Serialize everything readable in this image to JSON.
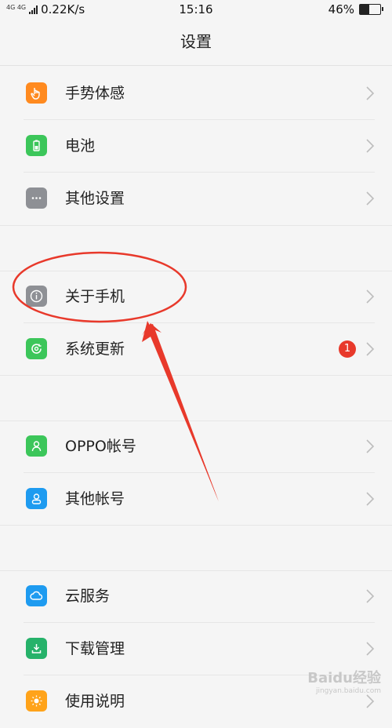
{
  "status_bar": {
    "network": "4G 4G",
    "speed": "0.22K/s",
    "time": "15:16",
    "battery": "46%",
    "battery_level": 0.46
  },
  "header": {
    "title": "设置"
  },
  "items": [
    {
      "label": "手势体感",
      "icon": "hand-gesture-icon",
      "color": "#ff8a1f"
    },
    {
      "label": "电池",
      "icon": "battery-icon",
      "color": "#3cc65a"
    },
    {
      "label": "其他设置",
      "icon": "more-dots-icon",
      "color": "#8e9095"
    },
    {
      "label": "关于手机",
      "icon": "info-icon",
      "color": "#8e9095"
    },
    {
      "label": "系统更新",
      "icon": "system-update-icon",
      "color": "#3cc65a",
      "badge": "1"
    },
    {
      "label": "OPPO帐号",
      "icon": "oppo-account-icon",
      "color": "#3cc65a"
    },
    {
      "label": "其他帐号",
      "icon": "other-account-icon",
      "color": "#1e9bf0"
    },
    {
      "label": "云服务",
      "icon": "cloud-icon",
      "color": "#1e9bf0"
    },
    {
      "label": "下载管理",
      "icon": "download-icon",
      "color": "#26b26a"
    },
    {
      "label": "使用说明",
      "icon": "help-icon",
      "color": "#ffa31a"
    }
  ],
  "colors": {
    "annotation": "#e8392b"
  },
  "watermark": {
    "text": "Baidu经验",
    "subtext": "jingyan.baidu.com"
  }
}
